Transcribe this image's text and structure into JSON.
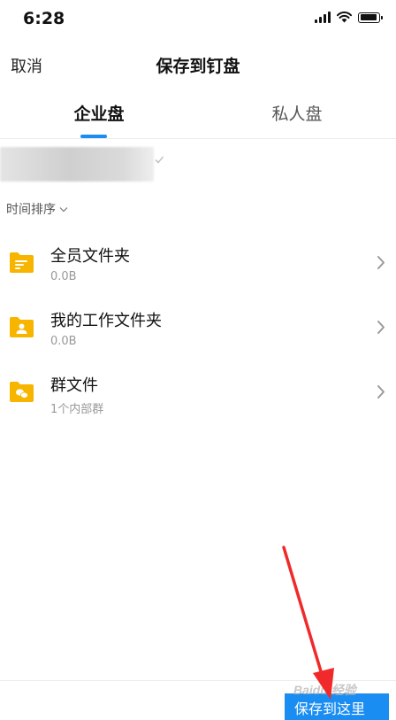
{
  "status_bar": {
    "time": "6:28",
    "signal_icon": "signal-icon",
    "wifi_icon": "wifi-icon",
    "battery_icon": "battery-icon",
    "battery_level": 0.9
  },
  "nav": {
    "cancel_label": "取消",
    "title": "保存到钉盘"
  },
  "tabs": [
    {
      "label": "企业盘",
      "active": true
    },
    {
      "label": "私人盘",
      "active": false
    }
  ],
  "breadcrumb": {
    "check_icon": "check-icon"
  },
  "sort": {
    "label": "时间排序",
    "icon": "chevron-down-icon"
  },
  "folders": [
    {
      "name": "全员文件夹",
      "meta": "0.0B",
      "icon": "folder-lines-icon"
    },
    {
      "name": "我的工作文件夹",
      "meta": "0.0B",
      "icon": "folder-user-icon"
    },
    {
      "name": "群文件",
      "meta": "1个内部群",
      "icon": "folder-chat-icon"
    }
  ],
  "bottom": {
    "save_label": "保存到这里",
    "watermark": "Baidu 经验"
  },
  "colors": {
    "accent": "#1a8df2",
    "folder": "#f7b500",
    "annotation_arrow": "#f02a2a"
  }
}
